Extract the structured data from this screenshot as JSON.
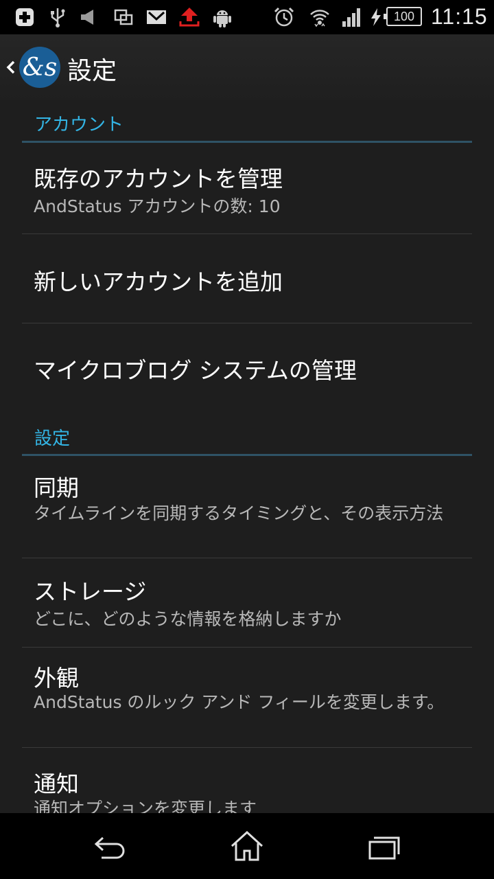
{
  "status_bar": {
    "icons": [
      "plus-icon",
      "usb-icon",
      "speaker-icon",
      "screen-icon",
      "mail-icon",
      "upload-icon",
      "android-icon",
      "alarm-icon",
      "wifi-icon",
      "signal-icon",
      "charging-icon"
    ],
    "battery_level": "100",
    "time": "11:15",
    "accent_colors": {
      "upload": "#e02020"
    }
  },
  "action_bar": {
    "title": "設定",
    "logo_text": "&s"
  },
  "sections": [
    {
      "header": "アカウント",
      "items": [
        {
          "title": "既存のアカウントを管理",
          "summary": "AndStatus アカウントの数: 10"
        },
        {
          "title": "新しいアカウントを追加"
        },
        {
          "title": "マイクロブログ システムの管理"
        }
      ]
    },
    {
      "header": "設定",
      "items": [
        {
          "title": "同期",
          "summary": "タイムラインを同期するタイミングと、その表示方法"
        },
        {
          "title": "ストレージ",
          "summary": "どこに、どのような情報を格納しますか"
        },
        {
          "title": "外観",
          "summary": "AndStatus のルック アンド フィールを変更します。"
        },
        {
          "title": "通知",
          "summary": "通知オプションを変更します"
        }
      ]
    }
  ],
  "nav_bar": {
    "buttons": [
      "back-icon",
      "home-icon",
      "recent-apps-icon"
    ]
  },
  "colors": {
    "accent": "#33b5e5",
    "background": "#1e1e1e",
    "logo": "#1a5e96"
  }
}
